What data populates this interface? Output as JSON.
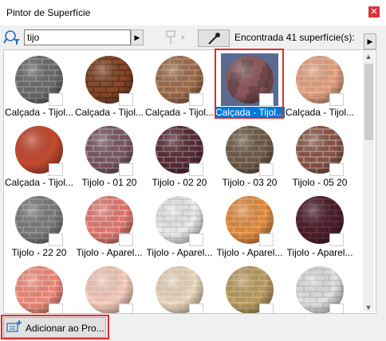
{
  "window": {
    "title": "Pintor de Superfície",
    "close_icon": "close-icon"
  },
  "toolbar": {
    "search_value": "tijo",
    "search_icon": "search-filter-icon",
    "found_text": "Encontrada 41 superfície(s):"
  },
  "colors": {
    "selection": "#0078d7",
    "highlight": "#e02b2b",
    "close": "#d7343b"
  },
  "surfaces": [
    {
      "label": "Calçada - Tijol...",
      "base": "#6b6b6b",
      "mortar": "#9a9a9a",
      "pattern": "brick"
    },
    {
      "label": "Calçada - Tijol...",
      "base": "#8a4a2a",
      "mortar": "#5a2e18",
      "pattern": "brick"
    },
    {
      "label": "Calçada - Tijol...",
      "base": "#9b6b4e",
      "mortar": "#c49a7a",
      "pattern": "brick"
    },
    {
      "label": "Calçada - Tijol...",
      "base": "#8e5a5e",
      "mortar": "#5d3c44",
      "pattern": "stone",
      "selected": true
    },
    {
      "label": "Calçada - Tijol...",
      "base": "#e3a080",
      "mortar": "#f0c0a8",
      "pattern": "brick"
    },
    {
      "label": "Calçada - Tijol...",
      "base": "#c44a30",
      "mortar": "#a23a25",
      "pattern": "smooth"
    },
    {
      "label": "Tijolo - 01 20",
      "base": "#7a5560",
      "mortar": "#a8a0a8",
      "pattern": "brick"
    },
    {
      "label": "Tijolo - 02 20",
      "base": "#5a2a35",
      "mortar": "#8f7f88",
      "pattern": "brick"
    },
    {
      "label": "Tijolo - 03 20",
      "base": "#6e5a48",
      "mortar": "#9a8a78",
      "pattern": "brick"
    },
    {
      "label": "Tijolo - 05 20",
      "base": "#8a5448",
      "mortar": "#c0a898",
      "pattern": "brick"
    },
    {
      "label": "Tijolo - 22 20",
      "base": "#7a7a7a",
      "mortar": "#a4a4a4",
      "pattern": "brick"
    },
    {
      "label": "Tijolo - Aparel...",
      "base": "#e07870",
      "mortar": "#f4b8b0",
      "pattern": "brick"
    },
    {
      "label": "Tijolo - Aparel...",
      "base": "#efefef",
      "mortar": "#cfcfcf",
      "pattern": "brick"
    },
    {
      "label": "Tijolo - Aparel...",
      "base": "#e08a40",
      "mortar": "#f4b070",
      "pattern": "brick"
    },
    {
      "label": "Tijolo - Aparel...",
      "base": "#4a1e2a",
      "mortar": "#6b3a45",
      "pattern": "brick"
    },
    {
      "label": "",
      "base": "#f08878",
      "mortar": "#f8c0b4",
      "pattern": "brick"
    },
    {
      "label": "",
      "base": "#f4c8b8",
      "mortar": "#fae0d6",
      "pattern": "brick"
    },
    {
      "label": "",
      "base": "#e8d4b8",
      "mortar": "#f4e8d8",
      "pattern": "brick"
    },
    {
      "label": "",
      "base": "#b89a60",
      "mortar": "#d4bc88",
      "pattern": "brick"
    },
    {
      "label": "",
      "base": "#e4e4e4",
      "mortar": "#c4c4c4",
      "pattern": "brick"
    }
  ],
  "footer": {
    "add_label": "Adicionar ao Pro...",
    "add_icon": "add-to-project-icon"
  }
}
